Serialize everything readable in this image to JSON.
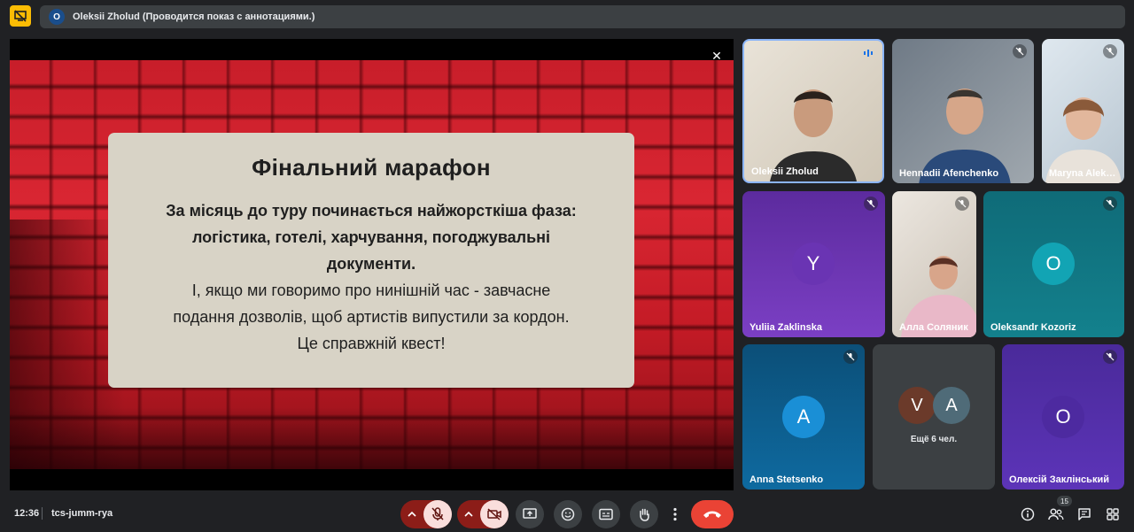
{
  "presentation_bar": {
    "presenter_initial": "O",
    "status_text": "Oleksii Zholud (Проводится показ с аннотациями.)"
  },
  "slide": {
    "title": "Фінальний марафон",
    "bold_lines": [
      "За місяць до туру починається найжорсткіша фаза:",
      "логістика, готелі, харчування, погоджувальні",
      "документи."
    ],
    "normal_lines": [
      "І, якщо ми говоримо про нинішній час - завчасне",
      "подання дозволів, щоб артистів випустили за кордон.",
      "Це справжній квест!"
    ]
  },
  "participants": [
    {
      "name": "Oleksii Zholud",
      "state": "speaking"
    },
    {
      "name": "Hennadii Afenchenko",
      "state": "muted"
    },
    {
      "name": "Maryna Alek…",
      "state": "muted"
    },
    {
      "name": "Yuliia Zaklinska",
      "initial": "Y",
      "state": "muted"
    },
    {
      "name": "Алла Соляник",
      "state": "muted"
    },
    {
      "name": "Oleksandr Kozoriz",
      "initial": "O",
      "state": "muted"
    },
    {
      "name": "Anna Stetsenko",
      "initial": "A",
      "state": "muted"
    },
    {
      "name": "Олексій Заклінський",
      "initial": "O",
      "state": "muted"
    }
  ],
  "others": {
    "initials": [
      "V",
      "A"
    ],
    "label": "Ещё 6 чел."
  },
  "bottom_bar": {
    "time": "12:36",
    "meeting_code": "tcs-jumm-rya",
    "people_count": "15"
  },
  "colors": {
    "accent_yellow": "#fbbc04",
    "end_call_red": "#ea4335",
    "muted_red": "#8c1d18",
    "speaking_blue": "#8ab4f8",
    "background": "#202124"
  },
  "icons": [
    "present-icon",
    "close-icon",
    "mic-off-icon",
    "camera-off-icon",
    "present-screen-icon",
    "emoji-icon",
    "captions-icon",
    "raise-hand-icon",
    "more-options-icon",
    "end-call-icon",
    "info-icon",
    "people-icon",
    "chat-icon",
    "activities-icon"
  ]
}
